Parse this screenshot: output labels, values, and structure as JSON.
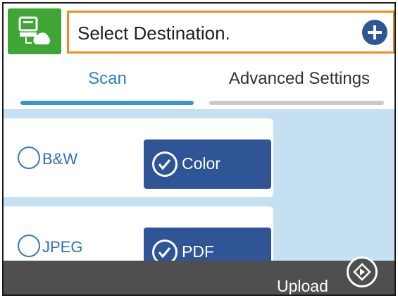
{
  "header": {
    "destination_placeholder": "Select Destination.",
    "add_icon": "plus-circle-icon",
    "app_icon": "scan-to-cloud-icon",
    "accent_colors": {
      "app_icon_bg": "#3fa535",
      "highlight_border": "#f08a1e",
      "add_button": "#2f5597"
    }
  },
  "tabs": [
    {
      "label": "Scan",
      "active": true
    },
    {
      "label": "Advanced Settings",
      "active": false
    }
  ],
  "color_mode": {
    "options": [
      {
        "label": "B&W",
        "selected": false
      },
      {
        "label": "Color",
        "selected": true
      }
    ]
  },
  "file_format": {
    "options": [
      {
        "label": "JPEG",
        "selected": false
      },
      {
        "label": "PDF",
        "selected": true
      }
    ]
  },
  "footer": {
    "upload_label": "Upload",
    "start_icon": "start-diamond-icon"
  }
}
